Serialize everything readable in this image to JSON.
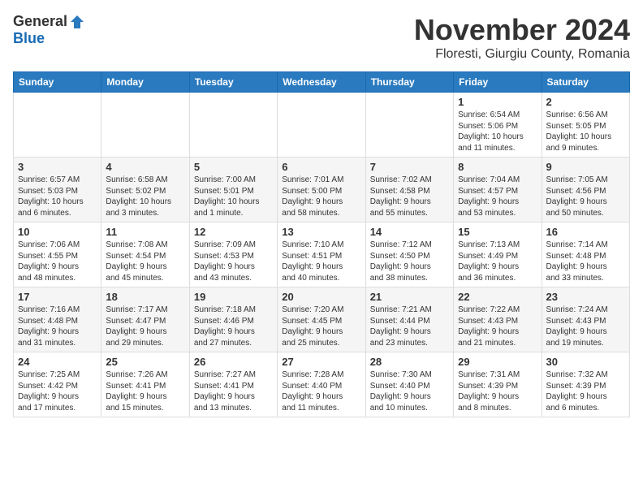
{
  "header": {
    "logo_general": "General",
    "logo_blue": "Blue",
    "month_title": "November 2024",
    "location": "Floresti, Giurgiu County, Romania"
  },
  "weekdays": [
    "Sunday",
    "Monday",
    "Tuesday",
    "Wednesday",
    "Thursday",
    "Friday",
    "Saturday"
  ],
  "weeks": [
    [
      {
        "day": "",
        "info": ""
      },
      {
        "day": "",
        "info": ""
      },
      {
        "day": "",
        "info": ""
      },
      {
        "day": "",
        "info": ""
      },
      {
        "day": "",
        "info": ""
      },
      {
        "day": "1",
        "info": "Sunrise: 6:54 AM\nSunset: 5:06 PM\nDaylight: 10 hours\nand 11 minutes."
      },
      {
        "day": "2",
        "info": "Sunrise: 6:56 AM\nSunset: 5:05 PM\nDaylight: 10 hours\nand 9 minutes."
      }
    ],
    [
      {
        "day": "3",
        "info": "Sunrise: 6:57 AM\nSunset: 5:03 PM\nDaylight: 10 hours\nand 6 minutes."
      },
      {
        "day": "4",
        "info": "Sunrise: 6:58 AM\nSunset: 5:02 PM\nDaylight: 10 hours\nand 3 minutes."
      },
      {
        "day": "5",
        "info": "Sunrise: 7:00 AM\nSunset: 5:01 PM\nDaylight: 10 hours\nand 1 minute."
      },
      {
        "day": "6",
        "info": "Sunrise: 7:01 AM\nSunset: 5:00 PM\nDaylight: 9 hours\nand 58 minutes."
      },
      {
        "day": "7",
        "info": "Sunrise: 7:02 AM\nSunset: 4:58 PM\nDaylight: 9 hours\nand 55 minutes."
      },
      {
        "day": "8",
        "info": "Sunrise: 7:04 AM\nSunset: 4:57 PM\nDaylight: 9 hours\nand 53 minutes."
      },
      {
        "day": "9",
        "info": "Sunrise: 7:05 AM\nSunset: 4:56 PM\nDaylight: 9 hours\nand 50 minutes."
      }
    ],
    [
      {
        "day": "10",
        "info": "Sunrise: 7:06 AM\nSunset: 4:55 PM\nDaylight: 9 hours\nand 48 minutes."
      },
      {
        "day": "11",
        "info": "Sunrise: 7:08 AM\nSunset: 4:54 PM\nDaylight: 9 hours\nand 45 minutes."
      },
      {
        "day": "12",
        "info": "Sunrise: 7:09 AM\nSunset: 4:53 PM\nDaylight: 9 hours\nand 43 minutes."
      },
      {
        "day": "13",
        "info": "Sunrise: 7:10 AM\nSunset: 4:51 PM\nDaylight: 9 hours\nand 40 minutes."
      },
      {
        "day": "14",
        "info": "Sunrise: 7:12 AM\nSunset: 4:50 PM\nDaylight: 9 hours\nand 38 minutes."
      },
      {
        "day": "15",
        "info": "Sunrise: 7:13 AM\nSunset: 4:49 PM\nDaylight: 9 hours\nand 36 minutes."
      },
      {
        "day": "16",
        "info": "Sunrise: 7:14 AM\nSunset: 4:48 PM\nDaylight: 9 hours\nand 33 minutes."
      }
    ],
    [
      {
        "day": "17",
        "info": "Sunrise: 7:16 AM\nSunset: 4:48 PM\nDaylight: 9 hours\nand 31 minutes."
      },
      {
        "day": "18",
        "info": "Sunrise: 7:17 AM\nSunset: 4:47 PM\nDaylight: 9 hours\nand 29 minutes."
      },
      {
        "day": "19",
        "info": "Sunrise: 7:18 AM\nSunset: 4:46 PM\nDaylight: 9 hours\nand 27 minutes."
      },
      {
        "day": "20",
        "info": "Sunrise: 7:20 AM\nSunset: 4:45 PM\nDaylight: 9 hours\nand 25 minutes."
      },
      {
        "day": "21",
        "info": "Sunrise: 7:21 AM\nSunset: 4:44 PM\nDaylight: 9 hours\nand 23 minutes."
      },
      {
        "day": "22",
        "info": "Sunrise: 7:22 AM\nSunset: 4:43 PM\nDaylight: 9 hours\nand 21 minutes."
      },
      {
        "day": "23",
        "info": "Sunrise: 7:24 AM\nSunset: 4:43 PM\nDaylight: 9 hours\nand 19 minutes."
      }
    ],
    [
      {
        "day": "24",
        "info": "Sunrise: 7:25 AM\nSunset: 4:42 PM\nDaylight: 9 hours\nand 17 minutes."
      },
      {
        "day": "25",
        "info": "Sunrise: 7:26 AM\nSunset: 4:41 PM\nDaylight: 9 hours\nand 15 minutes."
      },
      {
        "day": "26",
        "info": "Sunrise: 7:27 AM\nSunset: 4:41 PM\nDaylight: 9 hours\nand 13 minutes."
      },
      {
        "day": "27",
        "info": "Sunrise: 7:28 AM\nSunset: 4:40 PM\nDaylight: 9 hours\nand 11 minutes."
      },
      {
        "day": "28",
        "info": "Sunrise: 7:30 AM\nSunset: 4:40 PM\nDaylight: 9 hours\nand 10 minutes."
      },
      {
        "day": "29",
        "info": "Sunrise: 7:31 AM\nSunset: 4:39 PM\nDaylight: 9 hours\nand 8 minutes."
      },
      {
        "day": "30",
        "info": "Sunrise: 7:32 AM\nSunset: 4:39 PM\nDaylight: 9 hours\nand 6 minutes."
      }
    ]
  ]
}
